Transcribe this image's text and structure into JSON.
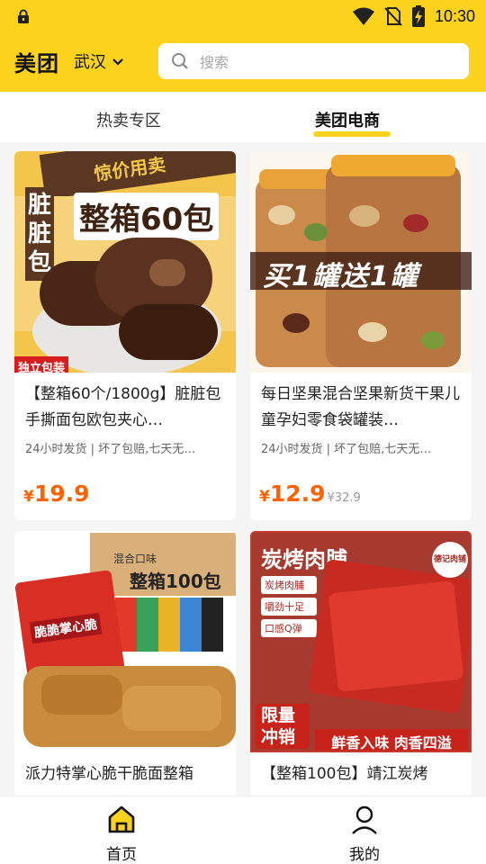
{
  "status": {
    "time": "10:30"
  },
  "header": {
    "brand": "美团",
    "city": "武汉",
    "search_placeholder": "搜索"
  },
  "tabs": [
    {
      "label": "热卖专区"
    },
    {
      "label": "美团电商"
    }
  ],
  "products": [
    {
      "title": "【整箱60个/1800g】脏脏包手撕面包欧包夹心…",
      "meta": "24小时发货 | 坏了包赔,七天无…",
      "price_yen": "¥",
      "price": "19.9",
      "orig_price": "",
      "img": {
        "banner": "惊价用卖",
        "side": "脏脏包",
        "headline": "整箱60包",
        "tag": "独立包装"
      }
    },
    {
      "title": "每日坚果混合坚果新货干果儿童孕妇零食袋罐装…",
      "meta": "24小时发货 | 坏了包赔,七天无…",
      "price_yen": "¥",
      "price": "12.9",
      "orig_price": "¥32.9",
      "img": {
        "headline": "买1罐送1罐"
      }
    },
    {
      "title": "派力特掌心脆干脆面整箱",
      "img": {
        "box": "整箱100包",
        "box_small": "混合口味",
        "bag": "脆脆掌心脆"
      }
    },
    {
      "title": "【整箱100包】靖江炭烤",
      "img": {
        "headline": "炭烤肉脯",
        "chips": [
          "炭烤肉脯",
          "嚼劲十足",
          "口感Q弹"
        ],
        "badge": "限量冲销",
        "bottom": "鲜香入味 肉香四溢",
        "stamp": "德记肉铺"
      }
    }
  ],
  "nav": [
    {
      "label": "首页"
    },
    {
      "label": "我的"
    }
  ],
  "colors": {
    "brand_yellow": "#fcd21c",
    "price_orange": "#ff6200"
  }
}
